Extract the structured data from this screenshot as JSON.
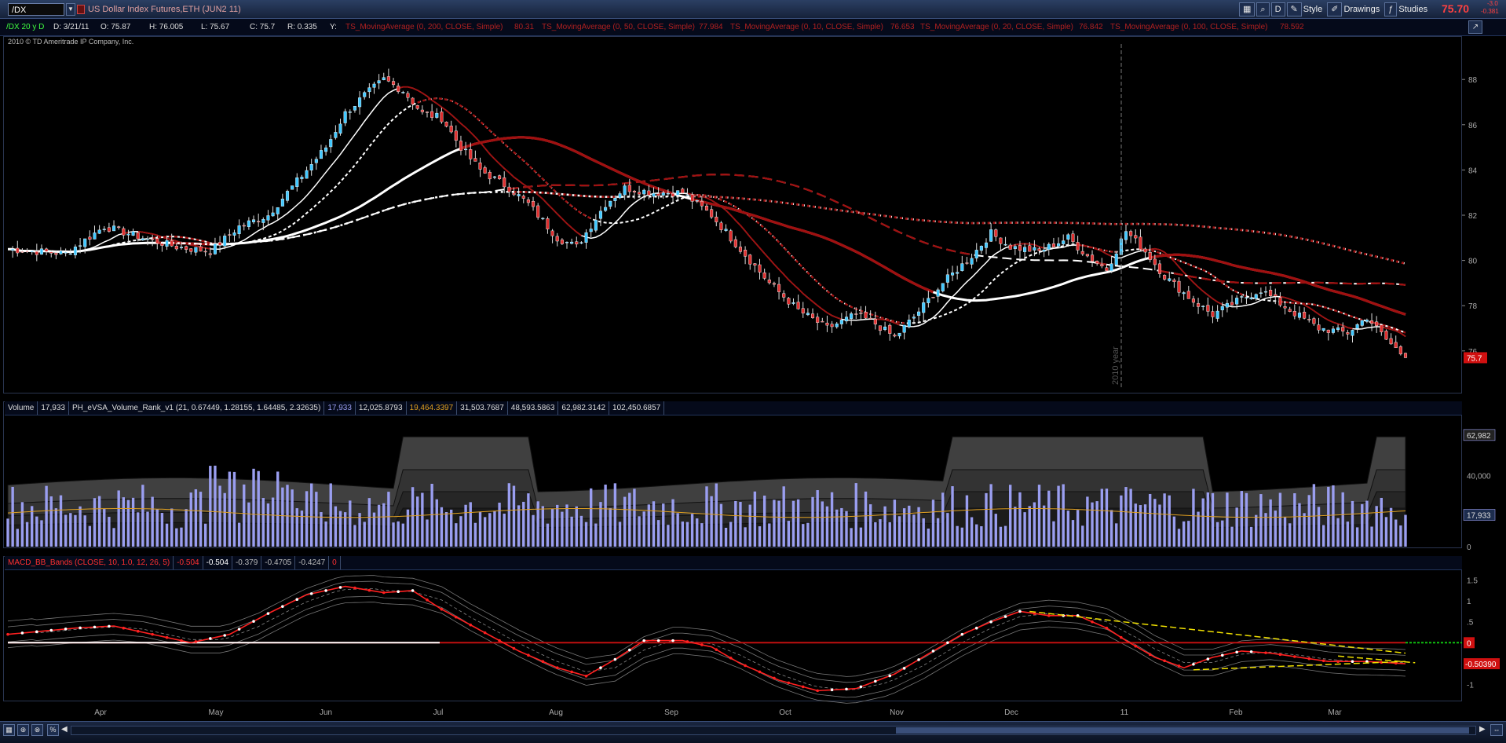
{
  "toolbar": {
    "symbol": "/DX",
    "title": "US Dollar Index Futures,ETH (JUN2 11)",
    "btn_d": "D",
    "btn_style": "Style",
    "btn_drawings": "Drawings",
    "btn_studies": "Studies",
    "last_price": "75.70",
    "change_top": "-3.0",
    "change_bottom": "-0.381"
  },
  "chart_header": {
    "period": "/DX 20 y D",
    "date": "D: 3/21/11",
    "open": "O: 75.87",
    "high": "H: 76.005",
    "low": "L: 75.67",
    "close": "C: 75.7",
    "range": "R: 0.335",
    "y_label": "Y:",
    "studies": [
      {
        "label": "TS_MovingAverage (0, 200, CLOSE, Simple)",
        "value": "80.31"
      },
      {
        "label": "TS_MovingAverage (0, 50, CLOSE, Simple)",
        "value": "77.984"
      },
      {
        "label": "TS_MovingAverage (0, 10, CLOSE, Simple)",
        "value": "76.653"
      },
      {
        "label": "TS_MovingAverage (0, 20, CLOSE, Simple)",
        "value": "76.842"
      },
      {
        "label": "TS_MovingAverage (0, 100, CLOSE, Simple)",
        "value": "78.592"
      }
    ],
    "copyright": "2010 © TD Ameritrade IP Company, Inc.",
    "year_marker": "2010 year",
    "price_badge": "75.7"
  },
  "volume_header": {
    "name": "Volume",
    "value": "17,933",
    "study": "PH_eVSA_Volume_Rank_v1 (21, 0.67449, 1.28155, 1.64485, 2.32635)",
    "values": [
      "17,933",
      "12,025.8793",
      "19,464.3397",
      "31,503.7687",
      "48,593.5863",
      "62,982.3142",
      "102,450.6857"
    ],
    "badge_top": "62,982",
    "badge_last": "17,933"
  },
  "macd_header": {
    "name": "MACD_BB_Bands (CLOSE, 10, 1.0, 12, 26, 5)",
    "values": [
      "-0.504",
      "-0.504",
      "-0.379",
      "-0.4705",
      "-0.4247",
      "0"
    ],
    "badge_zero": "0",
    "badge_last": "-0.50390"
  },
  "colors": {
    "bull": "#40c8ff",
    "bear": "#e03030",
    "ma_white": "#ffffff",
    "ma_red": "#a01010",
    "volume_bar": "#9a9ef0",
    "volume_avg": "#e0a020",
    "macd_line": "#ff2020",
    "macd_trend": "#f0e000"
  },
  "chart_data": [
    {
      "type": "candlestick",
      "title": "US Dollar Index Futures,ETH (JUN2 11)",
      "x_ticks": [
        "Apr",
        "May",
        "Jun",
        "Jul",
        "Aug",
        "Sep",
        "Oct",
        "Nov",
        "Dec",
        "11",
        "Feb",
        "Mar"
      ],
      "y_ticks": [
        76,
        78,
        80,
        82,
        84,
        86,
        88
      ],
      "ylim": [
        74.5,
        89.5
      ],
      "grid": false,
      "close_path": [
        [
          0,
          80.5
        ],
        [
          12,
          80.3
        ],
        [
          20,
          81.5
        ],
        [
          28,
          81.0
        ],
        [
          35,
          80.6
        ],
        [
          42,
          80.4
        ],
        [
          48,
          81.5
        ],
        [
          54,
          82.0
        ],
        [
          60,
          83.5
        ],
        [
          66,
          85.0
        ],
        [
          70,
          86.5
        ],
        [
          74,
          87.3
        ],
        [
          78,
          88.0
        ],
        [
          82,
          87.5
        ],
        [
          86,
          86.5
        ],
        [
          90,
          86.3
        ],
        [
          94,
          85.0
        ],
        [
          98,
          84.0
        ],
        [
          104,
          83.2
        ],
        [
          108,
          82.5
        ],
        [
          114,
          81.0
        ],
        [
          118,
          80.6
        ],
        [
          124,
          82.5
        ],
        [
          128,
          83.2
        ],
        [
          134,
          83.0
        ],
        [
          140,
          83.0
        ],
        [
          146,
          82.0
        ],
        [
          152,
          80.5
        ],
        [
          158,
          79.0
        ],
        [
          164,
          77.8
        ],
        [
          170,
          77.0
        ],
        [
          176,
          77.6
        ],
        [
          180,
          77.2
        ],
        [
          184,
          76.6
        ],
        [
          188,
          77.5
        ],
        [
          194,
          79.0
        ],
        [
          200,
          80.2
        ],
        [
          204,
          81.2
        ],
        [
          208,
          80.6
        ],
        [
          214,
          80.4
        ],
        [
          220,
          81.0
        ],
        [
          224,
          80.2
        ],
        [
          228,
          79.6
        ],
        [
          232,
          81.3
        ],
        [
          236,
          80.4
        ],
        [
          240,
          79.3
        ],
        [
          246,
          78.2
        ],
        [
          250,
          77.6
        ],
        [
          256,
          78.3
        ],
        [
          260,
          78.7
        ],
        [
          266,
          77.8
        ],
        [
          272,
          77.0
        ],
        [
          278,
          76.8
        ],
        [
          282,
          77.5
        ],
        [
          286,
          76.5
        ],
        [
          290,
          75.7
        ]
      ],
      "moving_averages": [
        {
          "name": "TS_MovingAverage (0, 10, CLOSE, Simple)",
          "period": 10,
          "last": 76.653
        },
        {
          "name": "TS_MovingAverage (0, 20, CLOSE, Simple)",
          "period": 20,
          "last": 76.842
        },
        {
          "name": "TS_MovingAverage (0, 50, CLOSE, Simple)",
          "period": 50,
          "last": 77.984
        },
        {
          "name": "TS_MovingAverage (0, 100, CLOSE, Simple)",
          "period": 100,
          "last": 78.592
        },
        {
          "name": "TS_MovingAverage (0, 200, CLOSE, Simple)",
          "period": 200,
          "last": 80.31
        }
      ],
      "last_close": 75.7
    },
    {
      "type": "bar",
      "title": "Volume",
      "y_ticks": [
        0,
        17933,
        40000,
        62982
      ],
      "y_tick_labels": [
        "0",
        "17,933",
        "40,000",
        "62,982"
      ],
      "ylim": [
        0,
        70000
      ],
      "last_volume": 17933,
      "bands": [
        12025.8793,
        19464.3397,
        31503.7687,
        48593.5863,
        62982.3142,
        102450.6857
      ]
    },
    {
      "type": "line",
      "title": "MACD_BB_Bands (CLOSE, 10, 1.0, 12, 26, 5)",
      "y_ticks": [
        -1,
        -0.5,
        0,
        0.5,
        1,
        1.5
      ],
      "y_tick_labels": [
        "-1",
        "-.5",
        "0",
        ".5",
        "1",
        "1.5"
      ],
      "ylim": [
        -1.35,
        1.7
      ],
      "macd_path": [
        [
          0,
          0.2
        ],
        [
          14,
          0.35
        ],
        [
          22,
          0.4
        ],
        [
          30,
          0.2
        ],
        [
          38,
          0.0
        ],
        [
          46,
          0.2
        ],
        [
          54,
          0.7
        ],
        [
          62,
          1.15
        ],
        [
          70,
          1.35
        ],
        [
          78,
          1.2
        ],
        [
          84,
          1.25
        ],
        [
          90,
          0.8
        ],
        [
          98,
          0.3
        ],
        [
          106,
          -0.2
        ],
        [
          114,
          -0.6
        ],
        [
          120,
          -0.8
        ],
        [
          126,
          -0.4
        ],
        [
          132,
          0.05
        ],
        [
          140,
          0.05
        ],
        [
          146,
          -0.1
        ],
        [
          152,
          -0.5
        ],
        [
          160,
          -0.9
        ],
        [
          168,
          -1.15
        ],
        [
          176,
          -1.1
        ],
        [
          184,
          -0.75
        ],
        [
          192,
          -0.2
        ],
        [
          198,
          0.2
        ],
        [
          204,
          0.5
        ],
        [
          210,
          0.75
        ],
        [
          216,
          0.65
        ],
        [
          222,
          0.65
        ],
        [
          228,
          0.35
        ],
        [
          232,
          0.05
        ],
        [
          238,
          -0.35
        ],
        [
          244,
          -0.6
        ],
        [
          250,
          -0.35
        ],
        [
          256,
          -0.2
        ],
        [
          262,
          -0.25
        ],
        [
          268,
          -0.35
        ],
        [
          274,
          -0.45
        ],
        [
          282,
          -0.45
        ],
        [
          290,
          -0.504
        ]
      ],
      "last": -0.504
    }
  ]
}
